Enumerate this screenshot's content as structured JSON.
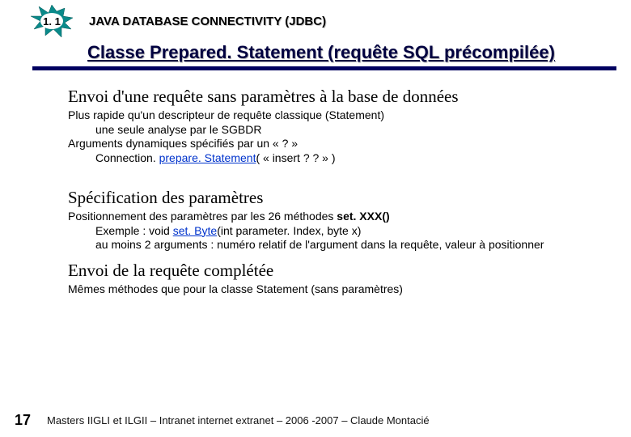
{
  "header": {
    "section_number": "1. 1",
    "chapter": "JAVA DATABASE CONNECTIVITY (JDBC)",
    "title": "Classe Prepared. Statement (requête SQL précompilée)"
  },
  "sections": {
    "s1": {
      "heading": "Envoi d'une requête sans paramètres à la base de données",
      "l1": "Plus rapide qu'un descripteur de requête  classique (Statement)",
      "l2": "une seule analyse par le SGBDR",
      "l3": "Arguments dynamiques spécifiés par un « ? »",
      "l4_pre": "Connection. ",
      "l4_link": "prepare. Statement",
      "l4_post": "( « insert ? ? » )"
    },
    "s2": {
      "heading": "Spécification des paramètres",
      "l1_pre": "Positionnement des paramètres par les 26 méthodes ",
      "l1_bold": "set. XXX()",
      "l2_pre": "Exemple : void ",
      "l2_link": "set. Byte",
      "l2_mid": "(int parameter. Index, ",
      "l2_byte": "byte",
      "l2_post": " x)",
      "l3": "au moins  2 arguments : numéro relatif de l'argument dans la requête, valeur à positionner"
    },
    "s3": {
      "heading": "Envoi de la requête complétée",
      "l1": "Mêmes méthodes que pour la classe Statement (sans paramètres)"
    }
  },
  "footer": {
    "page": "17",
    "text": "Masters IIGLI et ILGII – Intranet internet extranet – 2006 -2007 – Claude Montacié"
  }
}
